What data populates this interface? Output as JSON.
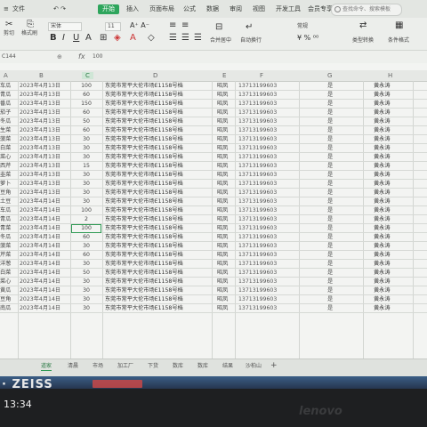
{
  "menu": {
    "tabs": [
      "开始",
      "插入",
      "页面布局",
      "公式",
      "数据",
      "审阅",
      "视图",
      "开发工具",
      "会员专享"
    ],
    "active": "开始",
    "search": "查找命令、搜索模板"
  },
  "toolbar": {
    "paste": "剪切",
    "format_painter": "格式刷",
    "font": "宋体",
    "font_size": "11",
    "merge": "合并居中",
    "wrap": "自动换行",
    "number_format": "常规",
    "type_convert": "类型转换",
    "cond_format": "条件格式"
  },
  "formula_bar": {
    "name_box": "C144",
    "fx": "fx",
    "value": "100"
  },
  "columns": [
    "A",
    "B",
    "C",
    "D",
    "E",
    "F",
    "G",
    "H"
  ],
  "rows": [
    {
      "name": "车瓜",
      "date": "2023年4月13日",
      "qty": "100",
      "addr": "东莞市常平大伦市场E1158号档",
      "p": "昭凤",
      "phone": "13713199603",
      "yes": "是",
      "person": "黄永涛"
    },
    {
      "name": "青瓜",
      "date": "2023年4月13日",
      "qty": "60",
      "addr": "东莞市常平大伦市场E1158号档",
      "p": "昭凤",
      "phone": "13713199603",
      "yes": "是",
      "person": "黄永涛"
    },
    {
      "name": "番瓜",
      "date": "2023年4月13日",
      "qty": "150",
      "addr": "东莞市常平大伦市场E1158号档",
      "p": "昭凤",
      "phone": "13713199603",
      "yes": "是",
      "person": "黄永涛"
    },
    {
      "name": "茄子",
      "date": "2023年4月13日",
      "qty": "60",
      "addr": "东莞市常平大伦市场E1158号档",
      "p": "昭凤",
      "phone": "13713199603",
      "yes": "是",
      "person": "黄永涛"
    },
    {
      "name": "冬瓜",
      "date": "2023年4月13日",
      "qty": "50",
      "addr": "东莞市常平大伦市场E1158号档",
      "p": "昭凤",
      "phone": "13713199603",
      "yes": "是",
      "person": "黄永涛"
    },
    {
      "name": "生菜",
      "date": "2023年4月13日",
      "qty": "60",
      "addr": "东莞市常平大伦市场E1158号档",
      "p": "昭凤",
      "phone": "13713199603",
      "yes": "是",
      "person": "黄永涛"
    },
    {
      "name": "菠菜",
      "date": "2023年4月13日",
      "qty": "30",
      "addr": "东莞市常平大伦市场E1158号档",
      "p": "昭凤",
      "phone": "13713199603",
      "yes": "是",
      "person": "黄永涛"
    },
    {
      "name": "白菜",
      "date": "2023年4月13日",
      "qty": "30",
      "addr": "东莞市常平大伦市场E1158号档",
      "p": "昭凤",
      "phone": "13713199603",
      "yes": "是",
      "person": "黄永涛"
    },
    {
      "name": "菜心",
      "date": "2023年4月13日",
      "qty": "30",
      "addr": "东莞市常平大伦市场E1158号档",
      "p": "昭凤",
      "phone": "13713199603",
      "yes": "是",
      "person": "黄永涛"
    },
    {
      "name": "西芹",
      "date": "2023年4月13日",
      "qty": "15",
      "addr": "东莞市常平大伦市场E1158号档",
      "p": "昭凤",
      "phone": "13713199603",
      "yes": "是",
      "person": "黄永涛"
    },
    {
      "name": "韭菜",
      "date": "2023年4月13日",
      "qty": "30",
      "addr": "东莞市常平大伦市场E1158号档",
      "p": "昭凤",
      "phone": "13713199603",
      "yes": "是",
      "person": "黄永涛"
    },
    {
      "name": "萝卜",
      "date": "2023年4月13日",
      "qty": "30",
      "addr": "东莞市常平大伦市场E1158号档",
      "p": "昭凤",
      "phone": "13713199603",
      "yes": "是",
      "person": "黄永涛"
    },
    {
      "name": "豆角",
      "date": "2023年4月13日",
      "qty": "30",
      "addr": "东莞市常平大伦市场E1158号档",
      "p": "昭凤",
      "phone": "13713199603",
      "yes": "是",
      "person": "黄永涛"
    },
    {
      "name": "土豆",
      "date": "2023年4月14日",
      "qty": "30",
      "addr": "东莞市常平大伦市场E1158号档",
      "p": "昭凤",
      "phone": "13713199603",
      "yes": "是",
      "person": "黄永涛"
    },
    {
      "name": "车瓜",
      "date": "2023年4月14日",
      "qty": "100",
      "addr": "东莞市常平大伦市场E1158号档",
      "p": "昭凤",
      "phone": "13713199603",
      "yes": "是",
      "person": "黄永涛"
    },
    {
      "name": "青瓜",
      "date": "2023年4月14日",
      "qty": "2",
      "addr": "东莞市常平大伦市场E1158号档",
      "p": "昭凤",
      "phone": "13713199603",
      "yes": "是",
      "person": "黄永涛"
    },
    {
      "name": "青菜",
      "date": "2023年4月14日",
      "qty": "100",
      "addr": "东莞市常平大伦市场E1158号档",
      "p": "昭凤",
      "phone": "13713199603",
      "yes": "是",
      "person": "黄永涛"
    },
    {
      "name": "冬瓜",
      "date": "2023年4月14日",
      "qty": "60",
      "addr": "东莞市常平大伦市场E1158号档",
      "p": "昭凤",
      "phone": "13713199603",
      "yes": "是",
      "person": "黄永涛"
    },
    {
      "name": "菠菜",
      "date": "2023年4月14日",
      "qty": "30",
      "addr": "东莞市常平大伦市场E1158号档",
      "p": "昭凤",
      "phone": "13713199603",
      "yes": "是",
      "person": "黄永涛"
    },
    {
      "name": "芹菜",
      "date": "2023年4月14日",
      "qty": "60",
      "addr": "东莞市常平大伦市场E1158号档",
      "p": "昭凤",
      "phone": "13713199603",
      "yes": "是",
      "person": "黄永涛"
    },
    {
      "name": "洋葱",
      "date": "2023年4月14日",
      "qty": "30",
      "addr": "东莞市常平大伦市场E1158号档",
      "p": "昭凤",
      "phone": "13713199603",
      "yes": "是",
      "person": "黄永涛"
    },
    {
      "name": "白菜",
      "date": "2023年4月14日",
      "qty": "50",
      "addr": "东莞市常平大伦市场E1158号档",
      "p": "昭凤",
      "phone": "13713199603",
      "yes": "是",
      "person": "黄永涛"
    },
    {
      "name": "菜心",
      "date": "2023年4月14日",
      "qty": "30",
      "addr": "东莞市常平大伦市场E1158号档",
      "p": "昭凤",
      "phone": "13713199603",
      "yes": "是",
      "person": "黄永涛"
    },
    {
      "name": "黄瓜",
      "date": "2023年4月14日",
      "qty": "30",
      "addr": "东莞市常平大伦市场E1158号档",
      "p": "昭凤",
      "phone": "13713199603",
      "yes": "是",
      "person": "黄永涛"
    },
    {
      "name": "豆角",
      "date": "2023年4月14日",
      "qty": "30",
      "addr": "东莞市常平大伦市场E1158号档",
      "p": "昭凤",
      "phone": "13713199603",
      "yes": "是",
      "person": "黄永涛"
    },
    {
      "name": "南瓜",
      "date": "2023年4月14日",
      "qty": "30",
      "addr": "东莞市常平大伦市场E1158号档",
      "p": "昭凤",
      "phone": "13713199603",
      "yes": "是",
      "person": "黄永涛"
    }
  ],
  "sheet_tabs": [
    "道家",
    "清晨",
    "市场",
    "加工厂",
    "下货",
    "数库",
    "数库",
    "结果",
    "沙柏山"
  ],
  "active_sheet": "道家",
  "bezel": {
    "camera_brand": "· ZEISS",
    "time": "13:34",
    "laptop_brand": "lenovo"
  }
}
